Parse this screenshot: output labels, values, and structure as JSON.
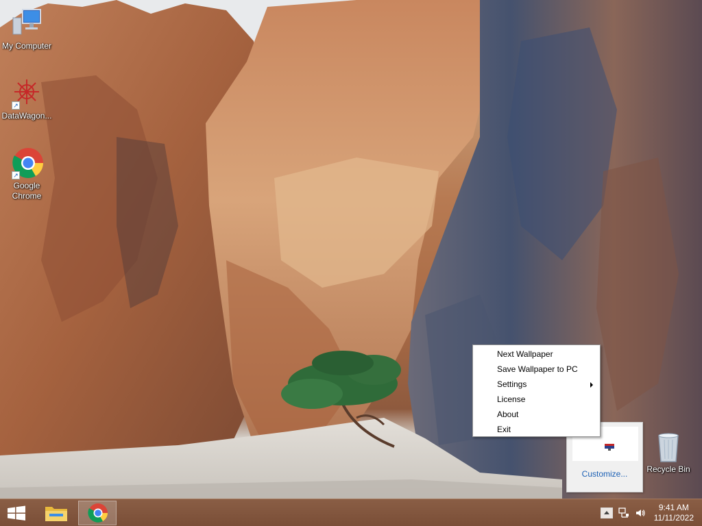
{
  "desktop": {
    "icons": [
      {
        "label": "My Computer",
        "icon": "computer-icon"
      },
      {
        "label": "DataWagon...",
        "icon": "datawagon-icon"
      },
      {
        "label": "Google Chrome",
        "icon": "chrome-icon"
      },
      {
        "label": "Recycle Bin",
        "icon": "recycle-bin-icon"
      }
    ]
  },
  "context_menu": {
    "items": [
      {
        "label": "Next Wallpaper",
        "has_submenu": false
      },
      {
        "label": "Save Wallpaper to PC",
        "has_submenu": false
      },
      {
        "label": "Settings",
        "has_submenu": true
      },
      {
        "label": "License",
        "has_submenu": false
      },
      {
        "label": "About",
        "has_submenu": false
      },
      {
        "label": "Exit",
        "has_submenu": false
      }
    ]
  },
  "tray_popup": {
    "customize_label": "Customize...",
    "icon": "wallpaper-app-tray-icon"
  },
  "taskbar": {
    "start_icon": "windows-logo-icon",
    "buttons": [
      {
        "name": "file-explorer",
        "icon": "folder-icon",
        "active": false
      },
      {
        "name": "google-chrome",
        "icon": "chrome-icon",
        "active": true
      }
    ],
    "tray_icons": [
      "show-hidden-icons-icon",
      "network-icon",
      "volume-icon"
    ],
    "time": "9:41 AM",
    "date": "11/11/2022"
  },
  "colors": {
    "taskbar": "#7a4e37",
    "link": "#1a5fb4",
    "menu_border": "#979797"
  }
}
